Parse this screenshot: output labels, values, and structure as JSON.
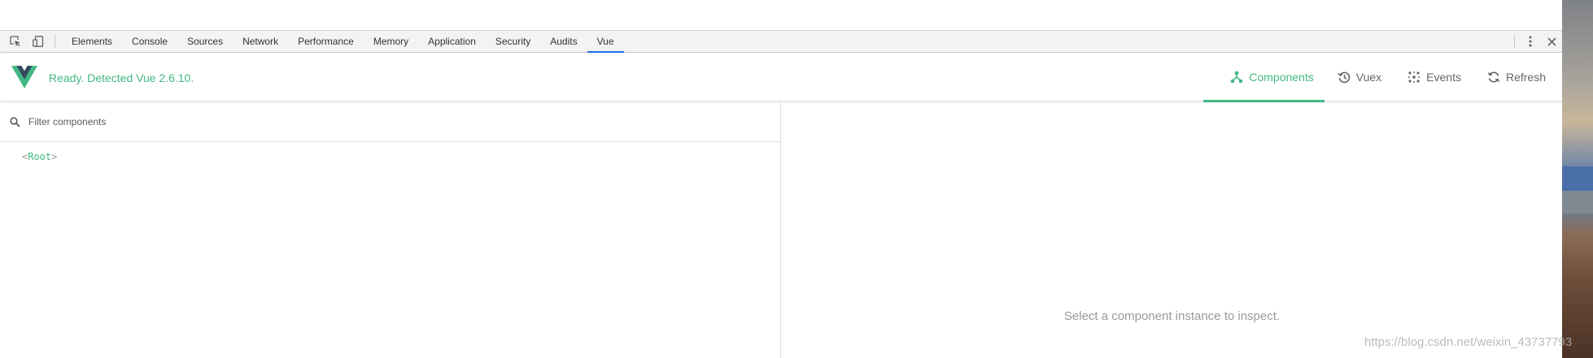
{
  "devtools": {
    "tabs": [
      {
        "label": "Elements"
      },
      {
        "label": "Console"
      },
      {
        "label": "Sources"
      },
      {
        "label": "Network"
      },
      {
        "label": "Performance"
      },
      {
        "label": "Memory"
      },
      {
        "label": "Application"
      },
      {
        "label": "Security"
      },
      {
        "label": "Audits"
      },
      {
        "label": "Vue",
        "active": true
      }
    ],
    "accent_color": "#1a73e8",
    "icons": [
      "inspect-element-icon",
      "device-toolbar-icon",
      "more-options-icon",
      "close-icon"
    ]
  },
  "vue_header": {
    "status": "Ready. Detected Vue 2.6.10.",
    "brand_color": "#42b983",
    "nav": [
      {
        "label": "Components",
        "icon": "components-icon",
        "active": true
      },
      {
        "label": "Vuex",
        "icon": "history-icon"
      },
      {
        "label": "Events",
        "icon": "events-icon"
      },
      {
        "label": "Refresh",
        "icon": "refresh-icon"
      }
    ]
  },
  "components_panel": {
    "filter_placeholder": "Filter components",
    "filter_value": "",
    "tree": [
      {
        "name": "Root",
        "open_bracket": "<",
        "close_bracket": ">"
      }
    ]
  },
  "inspector_panel": {
    "empty_message": "Select a component instance to inspect."
  },
  "watermark": "https://blog.csdn.net/weixin_43737793"
}
